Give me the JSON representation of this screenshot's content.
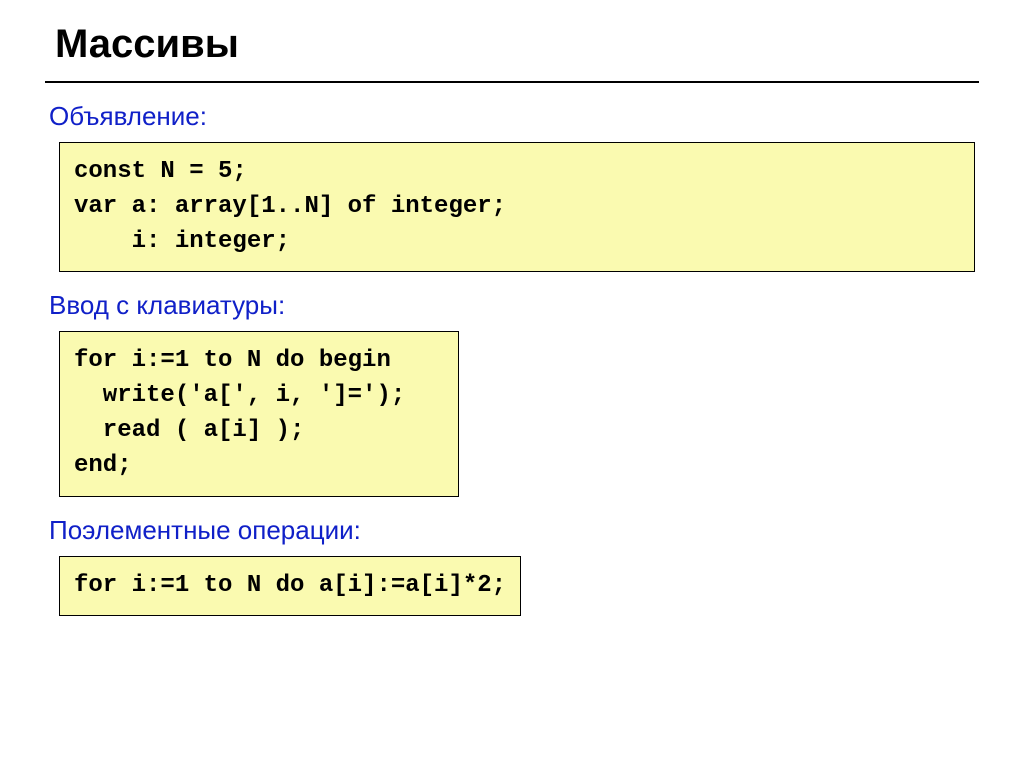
{
  "title": "Массивы",
  "sections": {
    "declaration": {
      "label": "Объявление:",
      "code": [
        "const N = 5;",
        "var a: array[1..N] of integer;",
        "    i: integer;"
      ]
    },
    "input": {
      "label": "Ввод с клавиатуры:",
      "code": [
        "for i:=1 to N do begin",
        "  write('a[', i, ']=');",
        "  read ( a[i] );",
        "end;"
      ]
    },
    "elementwise": {
      "label": "Поэлементные операции:",
      "code": [
        "for i:=1 to N do a[i]:=a[i]*2;"
      ]
    }
  }
}
